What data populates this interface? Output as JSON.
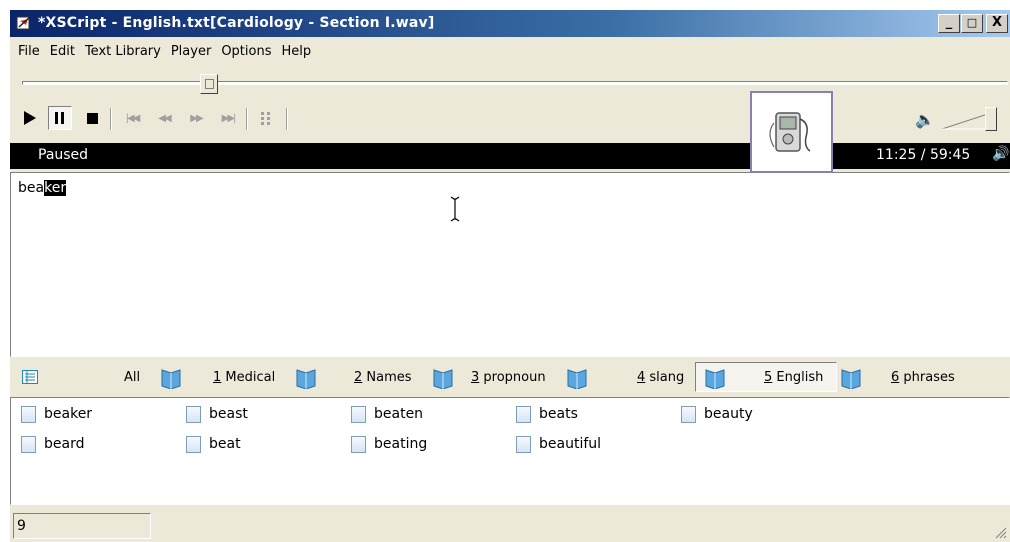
{
  "window": {
    "title": "*XSCript - English.txt[Cardiology - Section I.wav]",
    "minimize": "_",
    "maximize": "□",
    "close": "X"
  },
  "menu": [
    "File",
    "Edit",
    "Text Library",
    "Player",
    "Options",
    "Help"
  ],
  "player": {
    "state": "Paused",
    "time": "11:25 / 59:45",
    "position_fraction": 0.19,
    "volume_fraction": 0.95
  },
  "editor": {
    "text_plain": "bea",
    "text_selected": "ker"
  },
  "tabs": [
    {
      "label": "All",
      "accel": ""
    },
    {
      "accel": "1",
      "label": " Medical"
    },
    {
      "accel": "2",
      "label": " Names"
    },
    {
      "accel": "3",
      "label": " propnoun"
    },
    {
      "accel": "4",
      "label": " slang"
    },
    {
      "accel": "5",
      "label": " English"
    },
    {
      "accel": "6",
      "label": " phrases"
    }
  ],
  "selected_tab": "5 English",
  "words": [
    "beaker",
    "beard",
    "beast",
    "beat",
    "beaten",
    "beating",
    "beats",
    "beautiful",
    "beauty"
  ],
  "statusbar": {
    "count": "9"
  },
  "colors": {
    "title_gradient_start": "#0a246a",
    "title_gradient_end": "#a6caf0",
    "chrome": "#ece9d8",
    "status_strip": "#000000"
  }
}
